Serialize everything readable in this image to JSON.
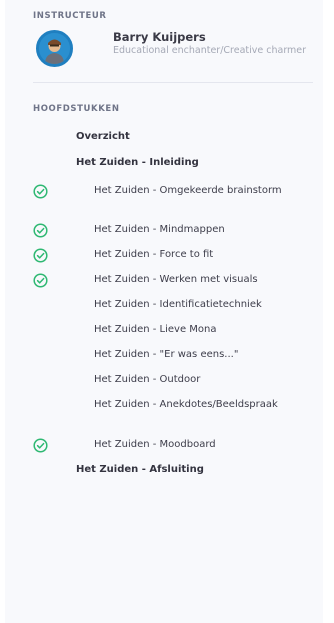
{
  "instructor": {
    "section_label": "INSTRUCTEUR",
    "name": "Barry Kuijpers",
    "role": "Educational enchanter/Creative charmer"
  },
  "chapters": {
    "section_label": "HOOFDSTUKKEN",
    "overview": "Overzicht",
    "intro_heading": "Het Zuiden - Inleiding",
    "lessons": [
      {
        "label": "Het Zuiden - Omgekeerde brainstorm",
        "completed": true
      },
      {
        "label": "Het Zuiden - Mindmappen",
        "completed": true
      },
      {
        "label": "Het Zuiden - Force to fit",
        "completed": true
      },
      {
        "label": "Het Zuiden - Werken met visuals",
        "completed": true
      },
      {
        "label": "Het Zuiden - Identificatietechniek",
        "completed": false
      },
      {
        "label": "Het Zuiden - Lieve Mona",
        "completed": false
      },
      {
        "label": "Het Zuiden - \"Er was eens...\"",
        "completed": false
      },
      {
        "label": "Het Zuiden - Outdoor",
        "completed": false
      },
      {
        "label": "Het Zuiden - Anekdotes/Beeldspraak",
        "completed": false
      },
      {
        "label": "Het Zuiden - Moodboard",
        "completed": true
      }
    ],
    "closing_heading": "Het Zuiden - Afsluiting"
  },
  "colors": {
    "check": "#2eb872",
    "avatar_bg": "#2a8fcf"
  }
}
